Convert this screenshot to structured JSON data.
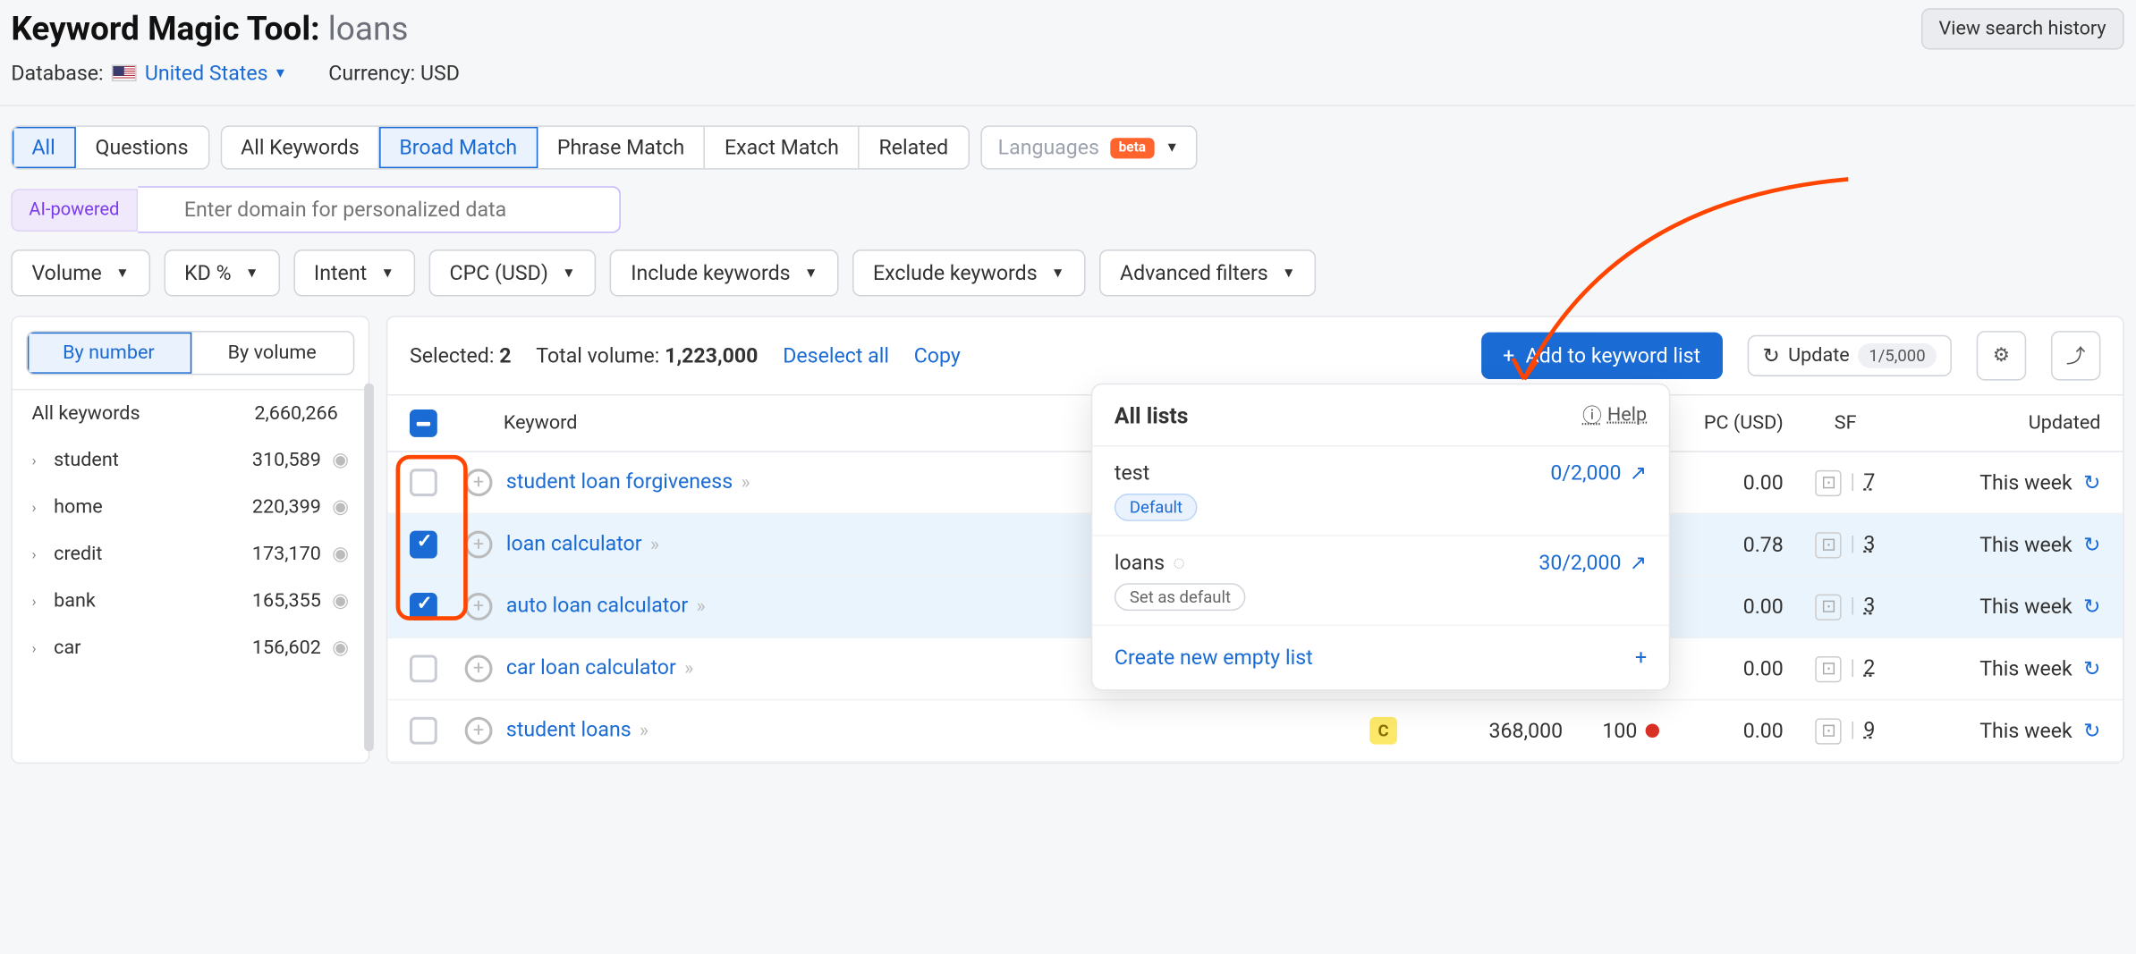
{
  "header": {
    "title_prefix": "Keyword Magic Tool:",
    "title_keyword": "loans",
    "history_btn": "View search history",
    "database_label": "Database:",
    "database_value": "United States",
    "currency_label": "Currency:",
    "currency_value": "USD"
  },
  "tabs_type": {
    "all": "All",
    "questions": "Questions"
  },
  "tabs_match": {
    "all_kw": "All Keywords",
    "broad": "Broad Match",
    "phrase": "Phrase Match",
    "exact": "Exact Match",
    "related": "Related"
  },
  "languages": {
    "label": "Languages",
    "beta": "beta"
  },
  "ai": {
    "badge": "AI-powered",
    "placeholder": "Enter domain for personalized data"
  },
  "filters": {
    "volume": "Volume",
    "kd": "KD %",
    "intent": "Intent",
    "cpc": "CPC (USD)",
    "include": "Include keywords",
    "exclude": "Exclude keywords",
    "advanced": "Advanced filters"
  },
  "sidebar": {
    "by_number": "By number",
    "by_volume": "By volume",
    "all_label": "All keywords",
    "all_count": "2,660,266",
    "items": [
      {
        "name": "student",
        "count": "310,589"
      },
      {
        "name": "home",
        "count": "220,399"
      },
      {
        "name": "credit",
        "count": "173,170"
      },
      {
        "name": "bank",
        "count": "165,355"
      },
      {
        "name": "car",
        "count": "156,602"
      }
    ]
  },
  "main_top": {
    "selected_label": "Selected:",
    "selected_count": "2",
    "total_label": "Total volume:",
    "total_value": "1,223,000",
    "deselect": "Deselect all",
    "copy": "Copy",
    "add_btn": "Add to keyword list",
    "update": "Update",
    "update_count": "1/5,000"
  },
  "columns": {
    "keyword": "Keyword",
    "cpc": "PC (USD)",
    "sf": "SF",
    "updated": "Updated"
  },
  "rows": [
    {
      "checked": false,
      "kw": "student loan forgiveness",
      "cpc": "0.00",
      "sf": "7",
      "updated": "This week"
    },
    {
      "checked": true,
      "kw": "loan calculator",
      "cpc": "0.78",
      "sf": "3",
      "updated": "This week"
    },
    {
      "checked": true,
      "kw": "auto loan calculator",
      "cpc": "0.00",
      "sf": "3",
      "updated": "This week"
    },
    {
      "checked": false,
      "kw": "car loan calculator",
      "cpc": "0.00",
      "sf": "2",
      "updated": "This week",
      "has_extra": true
    },
    {
      "checked": false,
      "kw": "student loans",
      "intent": "C",
      "vol": "368,000",
      "kd": "100",
      "kd_color": "red",
      "cpc": "0.00",
      "sf": "9",
      "updated": "This week"
    }
  ],
  "popup": {
    "title": "All lists",
    "help": "Help",
    "items": [
      {
        "name": "test",
        "count": "0/2,000",
        "tag": "Default",
        "tag_class": "def"
      },
      {
        "name": "loans",
        "count": "30/2,000",
        "tag": "Set as default",
        "tag_class": "",
        "loading": true
      }
    ],
    "new_list": "Create new empty list"
  }
}
